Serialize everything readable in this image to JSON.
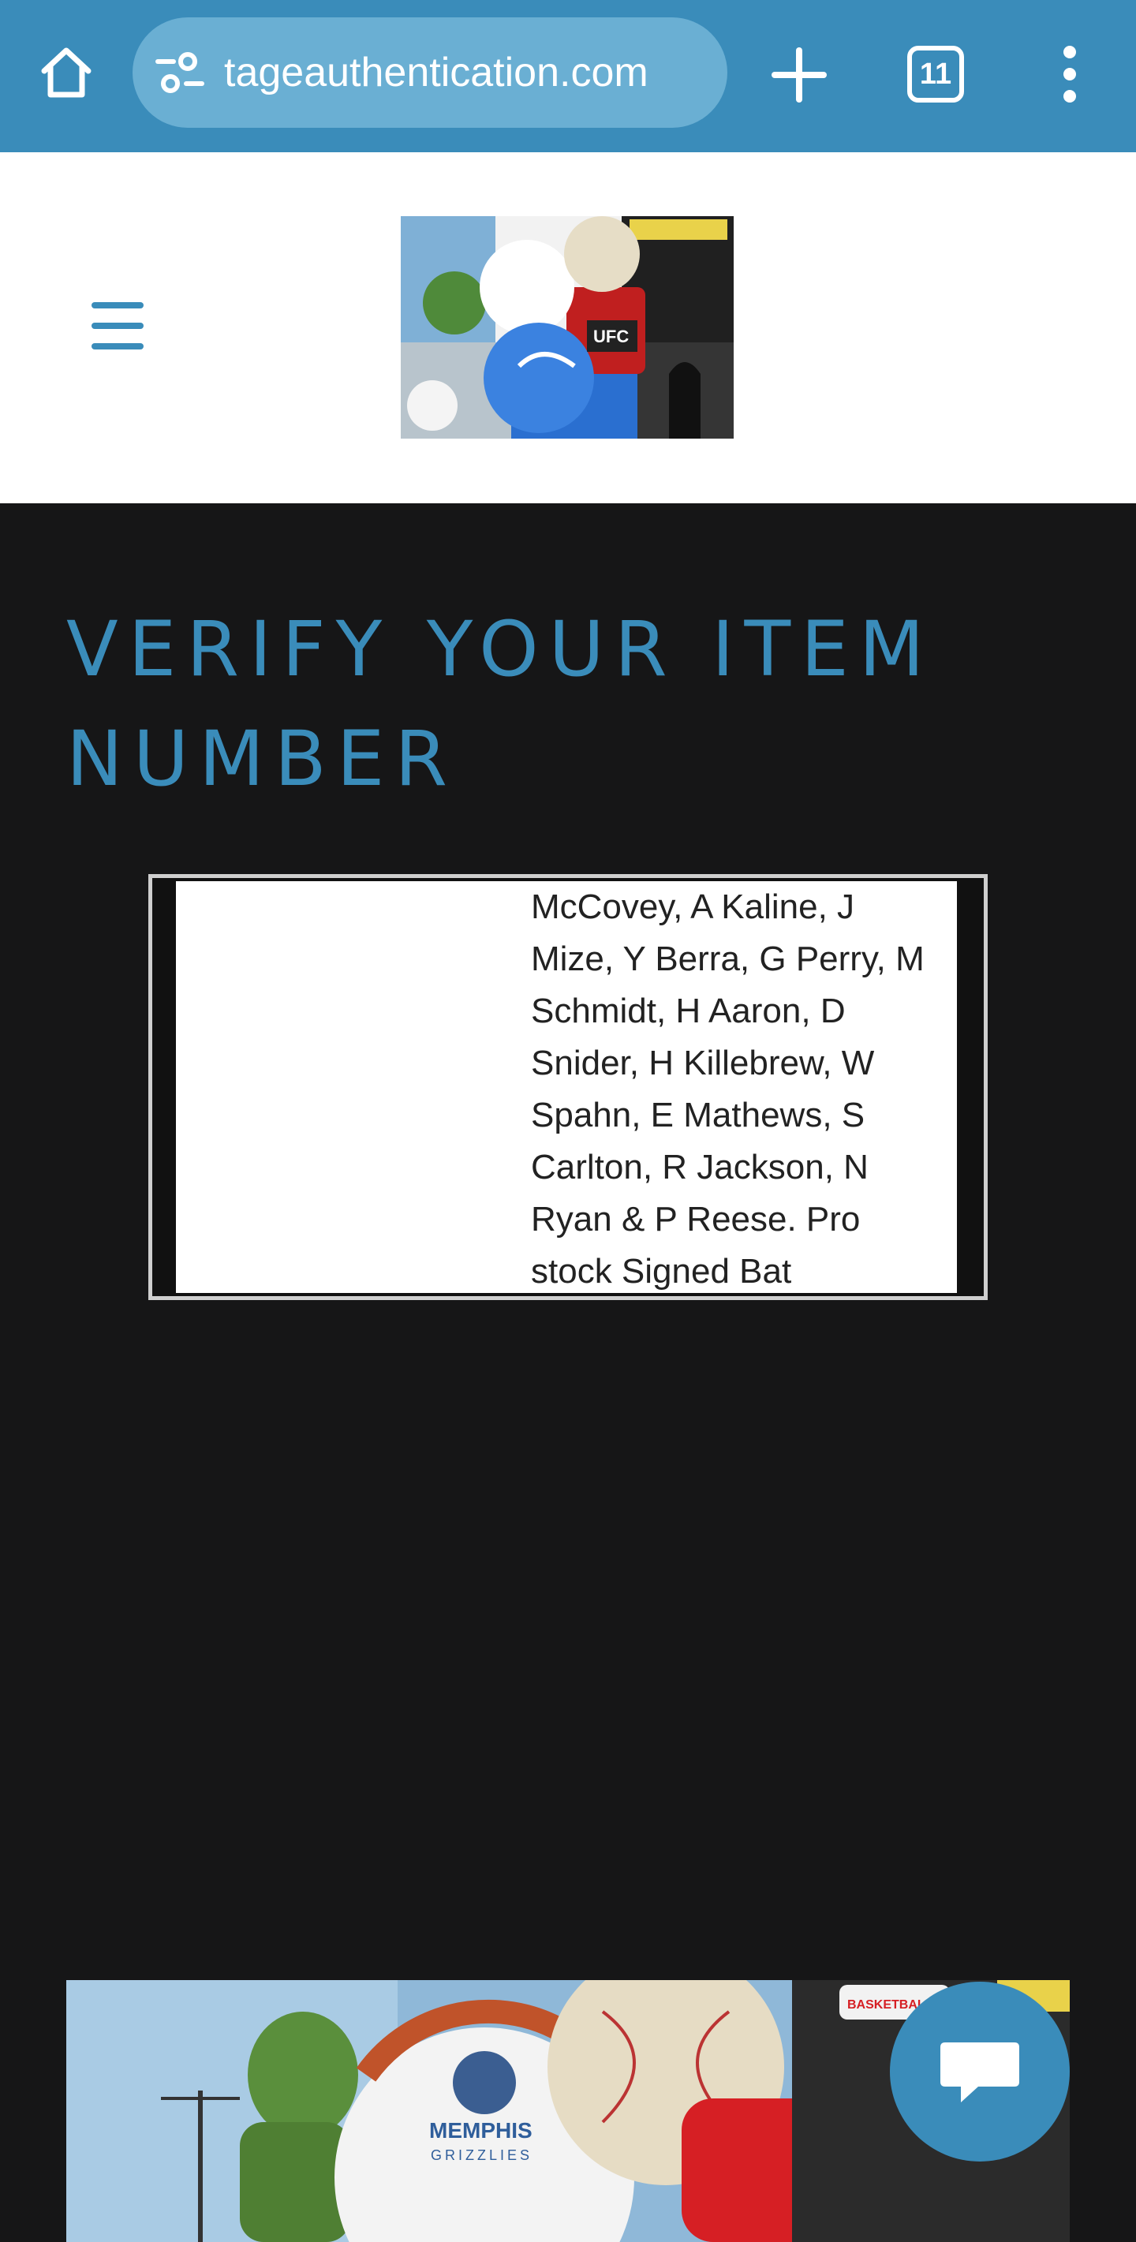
{
  "browser": {
    "url": "tageauthentication.com",
    "tab_count": "11"
  },
  "main": {
    "title": "VERIFY YOUR ITEM NUMBER",
    "item_description": "McCovey, A Kaline, J Mize, Y Berra, G Perry, M Schmidt, H Aaron, D Snider, H Killebrew, W Spahn, E Mathews, S Carlton, R Jackson, N Ryan & P Reese. Pro stock Signed Bat"
  },
  "banner": {
    "team_line1": "MEMPHIS",
    "team_line2": "GRIZZLIES",
    "popup_label": "BASKETBALL"
  },
  "logo": {
    "badge": "UFC"
  },
  "colors": {
    "accent": "#3a8cba",
    "page_bg": "#161617",
    "header_bg": "#ffffff"
  },
  "icons": {
    "home": "home-icon",
    "site_info": "site-settings-icon",
    "new_tab": "plus-icon",
    "tabs": "tab-switcher-icon",
    "overflow": "more-vert-icon",
    "menu": "hamburger-icon",
    "chat": "chat-bubble-icon"
  }
}
